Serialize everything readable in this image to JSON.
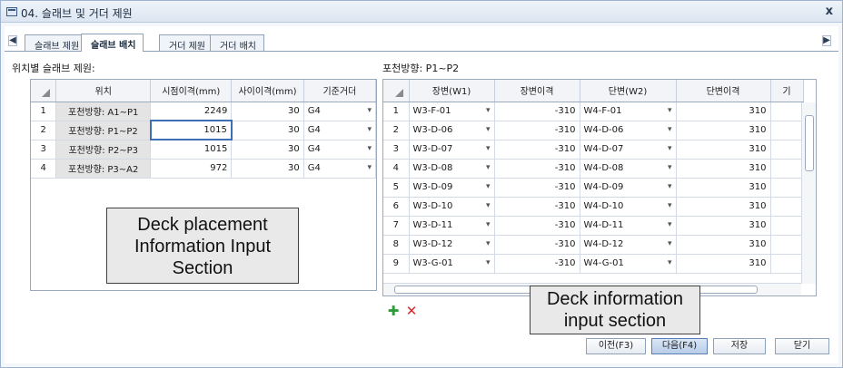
{
  "window": {
    "title": "04. 슬래브 및 거더 제원",
    "close": "x"
  },
  "tabs": {
    "left_arrow": "◀",
    "right_arrow": "▶",
    "items": [
      "슬래브 제원",
      "슬래브 배치",
      "거더 제원",
      "거더 배치"
    ],
    "active_index": 1
  },
  "left": {
    "label": "위치별 슬래브 제원:",
    "columns": [
      "위치",
      "시점이격(mm)",
      "사이이격(mm)",
      "기준거더"
    ],
    "rows": [
      {
        "n": "1",
        "loc": "포천방향: A1~P1",
        "start": "2249",
        "gap": "30",
        "girder": "G4"
      },
      {
        "n": "2",
        "loc": "포천방향: P1~P2",
        "start": "1015",
        "gap": "30",
        "girder": "G4"
      },
      {
        "n": "3",
        "loc": "포천방향: P2~P3",
        "start": "1015",
        "gap": "30",
        "girder": "G4"
      },
      {
        "n": "4",
        "loc": "포천방향: P3~A2",
        "start": "972",
        "gap": "30",
        "girder": "G4"
      }
    ],
    "callout": [
      "Deck placement",
      "Information Input",
      "Section"
    ]
  },
  "right": {
    "label": "포천방향: P1~P2",
    "columns": [
      "장변(W1)",
      "장변이격",
      "단변(W2)",
      "단변이격",
      "기"
    ],
    "rows": [
      {
        "n": "1",
        "w1": "W3-F-01",
        "w1gap": "-310",
        "w2": "W4-F-01",
        "w2gap": "310"
      },
      {
        "n": "2",
        "w1": "W3-D-06",
        "w1gap": "-310",
        "w2": "W4-D-06",
        "w2gap": "310"
      },
      {
        "n": "3",
        "w1": "W3-D-07",
        "w1gap": "-310",
        "w2": "W4-D-07",
        "w2gap": "310"
      },
      {
        "n": "4",
        "w1": "W3-D-08",
        "w1gap": "-310",
        "w2": "W4-D-08",
        "w2gap": "310"
      },
      {
        "n": "5",
        "w1": "W3-D-09",
        "w1gap": "-310",
        "w2": "W4-D-09",
        "w2gap": "310"
      },
      {
        "n": "6",
        "w1": "W3-D-10",
        "w1gap": "-310",
        "w2": "W4-D-10",
        "w2gap": "310"
      },
      {
        "n": "7",
        "w1": "W3-D-11",
        "w1gap": "-310",
        "w2": "W4-D-11",
        "w2gap": "310"
      },
      {
        "n": "8",
        "w1": "W3-D-12",
        "w1gap": "-310",
        "w2": "W4-D-12",
        "w2gap": "310"
      },
      {
        "n": "9",
        "w1": "W3-G-01",
        "w1gap": "-310",
        "w2": "W4-G-01",
        "w2gap": "310"
      }
    ],
    "callout": [
      "Deck information",
      "input section"
    ],
    "add_icon": "plus-icon",
    "delete_icon": "delete-x-icon"
  },
  "buttons": {
    "prev": "이전(F3)",
    "next": "다음(F4)",
    "save": "저장",
    "close": "닫기"
  },
  "colors": {
    "accent": "#3d6fb7",
    "add": "#2e9c3a",
    "delete": "#d6262b",
    "location_cell": "#e4e4e4"
  }
}
